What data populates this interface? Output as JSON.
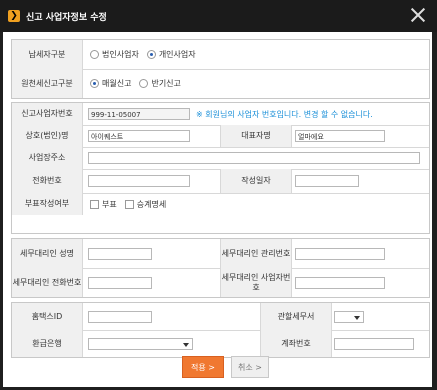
{
  "window": {
    "title": "신고 사업자정보 수정",
    "logo_glyph": "❯"
  },
  "group1": {
    "taxpayer_type": {
      "label": "납세자구분",
      "options": [
        "법인사업자",
        "개인사업자"
      ],
      "selected": "개인사업자"
    },
    "withholding_type": {
      "label": "원천세신고구분",
      "options": [
        "매월신고",
        "반기신고"
      ],
      "selected": "매월신고"
    }
  },
  "group2": {
    "business_no": {
      "label": "신고사업자번호",
      "value": "999-11-05007",
      "notice": "※ 회원님의 사업자 번호입니다. 변경 할 수 없습니다."
    },
    "company_name": {
      "label": "상호(법인)명",
      "value": "아이퀘스트"
    },
    "representative": {
      "label": "대표자명",
      "value": "얼마에요"
    },
    "address": {
      "label": "사업장주소",
      "value": ""
    },
    "phone": {
      "label": "전화번호",
      "value": ""
    },
    "date": {
      "label": "작성일자",
      "value": ""
    },
    "attachments": {
      "label": "부표작성여부",
      "options": [
        "부표",
        "승계명세"
      ]
    }
  },
  "group3": {
    "agent_name": {
      "label": "세무대리인 성명",
      "value": ""
    },
    "agent_mgmt_no": {
      "label": "세무대리인 관리번호",
      "value": ""
    },
    "agent_phone": {
      "label": "세무대리인 전화번호",
      "value": ""
    },
    "agent_biz_no": {
      "label": "세무대리인 사업자번호",
      "value": ""
    }
  },
  "group4": {
    "hometax_id": {
      "label": "홈택스ID",
      "value": ""
    },
    "tax_office": {
      "label": "관할세무서",
      "value": ""
    },
    "refund_bank": {
      "label": "환급은행",
      "value": ""
    },
    "account_no": {
      "label": "계좌번호",
      "value": ""
    }
  },
  "buttons": {
    "apply": "적용 >",
    "cancel": "취소 >"
  },
  "colors": {
    "accent": "#F07830",
    "notice": "#1A8FD8",
    "titlebar": "#1B1B1B"
  }
}
